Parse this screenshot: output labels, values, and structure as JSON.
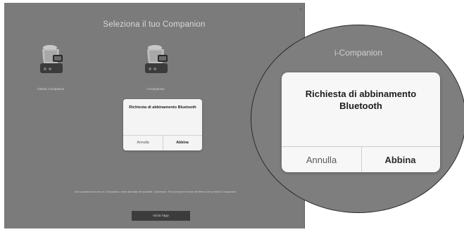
{
  "screen": {
    "title": "Seleziona il tuo Companion",
    "devices": [
      {
        "label": "Classic Companion",
        "icon": "cooking-robot-icon"
      },
      {
        "label": "i-Companion",
        "icon": "cooking-robot-icon"
      }
    ],
    "dialog": {
      "title": "Richiesta di abbinamento Bluetooth",
      "cancel_label": "Annulla",
      "pair_label": "Abbina"
    },
    "footer_text": "Non possiedi ancora un Companion, vieni alla lista dei prodotti / accessori. Puoi sempre tornare all'elenco dei prodotti Companion.",
    "start_button_label": "Inizia l'app"
  },
  "zoom": {
    "header": "i-Companion",
    "dialog": {
      "title": "Richiesta di abbinamento Bluetooth",
      "cancel_label": "Annulla",
      "pair_label": "Abbina"
    }
  },
  "colors": {
    "screen_bg": "#7b7b7b",
    "dialog_bg": "#f4f4f4",
    "button_dark": "#3c3c3c"
  }
}
